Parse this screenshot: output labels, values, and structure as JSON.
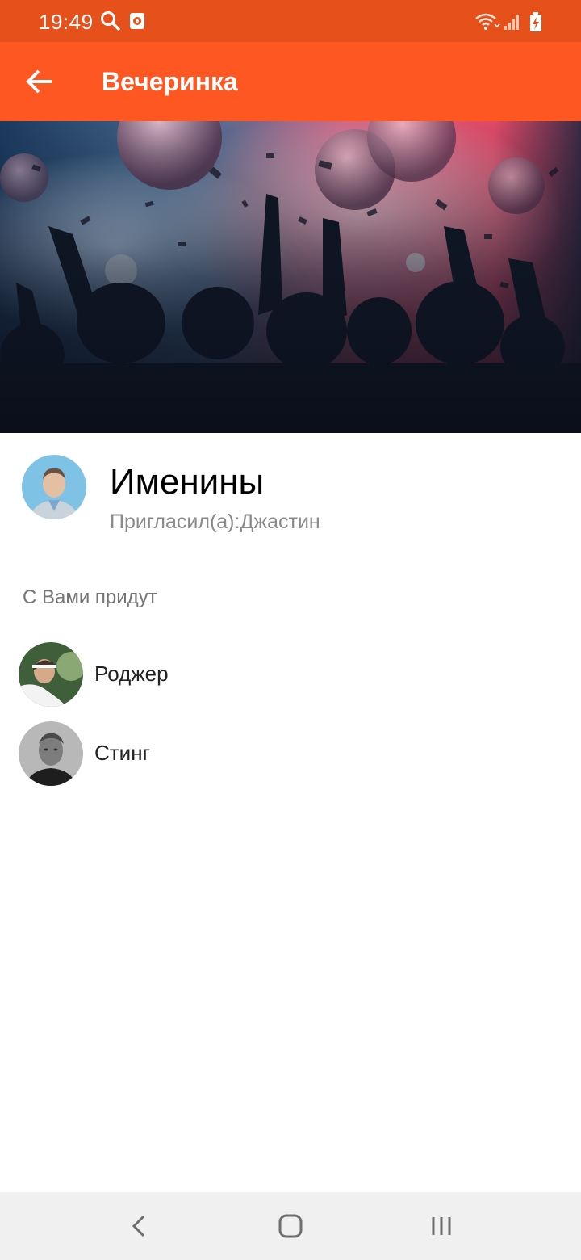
{
  "status_bar": {
    "time": "19:49",
    "icons": [
      "search-icon",
      "app-notification-icon",
      "wifi-icon",
      "cell-signal-icon",
      "battery-charging-icon"
    ],
    "background_color": "#e5501b"
  },
  "app_bar": {
    "title": "Вечеринка",
    "back_icon": "arrow-back-icon",
    "background_color": "#ff5722"
  },
  "event": {
    "name": "Именины",
    "invited_by": "Пригласил(а):Джастин"
  },
  "attendees": {
    "label": "С Вами придут",
    "items": [
      {
        "name": "Роджер"
      },
      {
        "name": "Стинг"
      }
    ]
  },
  "nav_bar": {
    "icons": [
      "nav-back-icon",
      "nav-home-icon",
      "nav-recent-apps-icon"
    ]
  }
}
